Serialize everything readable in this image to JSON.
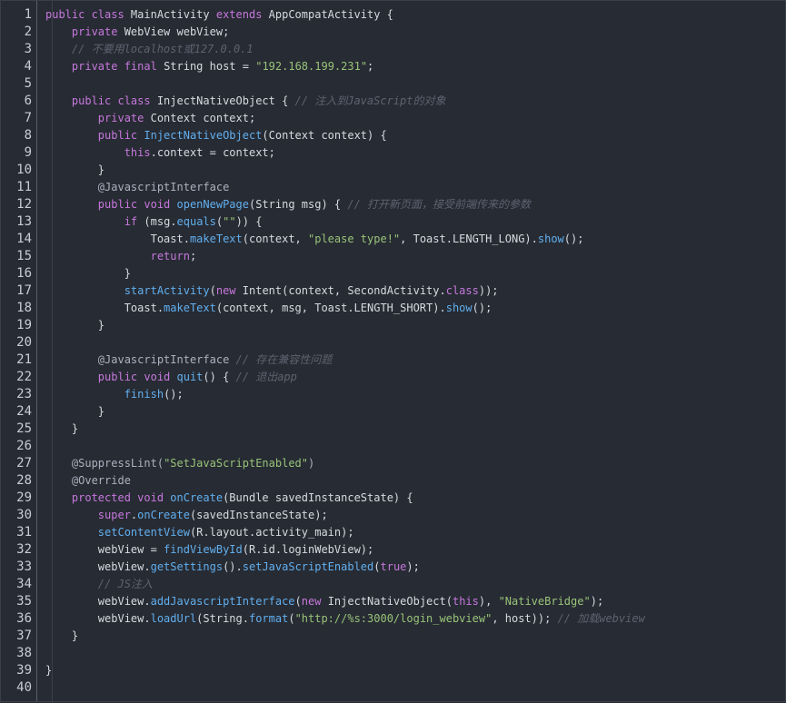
{
  "colors": {
    "background": "#272b33",
    "keyword": "#c678dd",
    "type": "#e5c07b",
    "function": "#61afef",
    "string": "#98c379",
    "comment": "#5c6370",
    "plain": "#d7dae0",
    "line_number": "#c8ccd4"
  },
  "lines": [
    {
      "n": "1",
      "t": [
        [
          "k",
          "public class "
        ],
        [
          "p",
          "MainActivity "
        ],
        [
          "k",
          "extends "
        ],
        [
          "p",
          "AppCompatActivity {"
        ]
      ]
    },
    {
      "n": "2",
      "t": [
        [
          "p",
          "    "
        ],
        [
          "k",
          "private "
        ],
        [
          "p",
          "WebView webView;"
        ]
      ]
    },
    {
      "n": "3",
      "t": [
        [
          "p",
          "    "
        ],
        [
          "c",
          "// 不要用localhost或127.0.0.1"
        ]
      ]
    },
    {
      "n": "4",
      "t": [
        [
          "p",
          "    "
        ],
        [
          "k",
          "private final "
        ],
        [
          "p",
          "String host = "
        ],
        [
          "s",
          "\"192.168.199.231\""
        ],
        [
          "p",
          ";"
        ]
      ]
    },
    {
      "n": "5",
      "t": []
    },
    {
      "n": "6",
      "t": [
        [
          "p",
          "    "
        ],
        [
          "k",
          "public class "
        ],
        [
          "p",
          "InjectNativeObject { "
        ],
        [
          "c",
          "// 注入到JavaScript的对象"
        ]
      ]
    },
    {
      "n": "7",
      "t": [
        [
          "p",
          "        "
        ],
        [
          "k",
          "private "
        ],
        [
          "p",
          "Context context;"
        ]
      ]
    },
    {
      "n": "8",
      "t": [
        [
          "p",
          "        "
        ],
        [
          "k",
          "public "
        ],
        [
          "f",
          "InjectNativeObject"
        ],
        [
          "p",
          "(Context context) {"
        ]
      ]
    },
    {
      "n": "9",
      "t": [
        [
          "p",
          "            "
        ],
        [
          "k",
          "this"
        ],
        [
          "p",
          ".context = context;"
        ]
      ]
    },
    {
      "n": "10",
      "t": [
        [
          "p",
          "        }"
        ]
      ]
    },
    {
      "n": "11",
      "t": [
        [
          "p",
          "        "
        ],
        [
          "a",
          "@JavascriptInterface"
        ]
      ]
    },
    {
      "n": "12",
      "t": [
        [
          "p",
          "        "
        ],
        [
          "k",
          "public void "
        ],
        [
          "f",
          "openNewPage"
        ],
        [
          "p",
          "(String msg) { "
        ],
        [
          "c",
          "// 打开新页面，接受前端传来的参数"
        ]
      ]
    },
    {
      "n": "13",
      "t": [
        [
          "p",
          "            "
        ],
        [
          "k",
          "if "
        ],
        [
          "p",
          "(msg."
        ],
        [
          "f",
          "equals"
        ],
        [
          "p",
          "("
        ],
        [
          "s",
          "\"\""
        ],
        [
          "p",
          ")) {"
        ]
      ]
    },
    {
      "n": "14",
      "t": [
        [
          "p",
          "                Toast."
        ],
        [
          "f",
          "makeText"
        ],
        [
          "p",
          "(context, "
        ],
        [
          "s",
          "\"please type!\""
        ],
        [
          "p",
          ", Toast.LENGTH_LONG)."
        ],
        [
          "f",
          "show"
        ],
        [
          "p",
          "();"
        ]
      ]
    },
    {
      "n": "15",
      "t": [
        [
          "p",
          "                "
        ],
        [
          "k",
          "return"
        ],
        [
          "p",
          ";"
        ]
      ]
    },
    {
      "n": "16",
      "t": [
        [
          "p",
          "            }"
        ]
      ]
    },
    {
      "n": "17",
      "t": [
        [
          "p",
          "            "
        ],
        [
          "f",
          "startActivity"
        ],
        [
          "p",
          "("
        ],
        [
          "k",
          "new "
        ],
        [
          "p",
          "Intent(context, SecondActivity."
        ],
        [
          "k",
          "class"
        ],
        [
          "p",
          "));"
        ]
      ]
    },
    {
      "n": "18",
      "t": [
        [
          "p",
          "            Toast."
        ],
        [
          "f",
          "makeText"
        ],
        [
          "p",
          "(context, msg, Toast.LENGTH_SHORT)."
        ],
        [
          "f",
          "show"
        ],
        [
          "p",
          "();"
        ]
      ]
    },
    {
      "n": "19",
      "t": [
        [
          "p",
          "        }"
        ]
      ]
    },
    {
      "n": "20",
      "t": []
    },
    {
      "n": "21",
      "t": [
        [
          "p",
          "        "
        ],
        [
          "a",
          "@JavascriptInterface "
        ],
        [
          "c",
          "// 存在兼容性问题"
        ]
      ]
    },
    {
      "n": "22",
      "t": [
        [
          "p",
          "        "
        ],
        [
          "k",
          "public void "
        ],
        [
          "f",
          "quit"
        ],
        [
          "p",
          "() { "
        ],
        [
          "c",
          "// 退出app"
        ]
      ]
    },
    {
      "n": "23",
      "t": [
        [
          "p",
          "            "
        ],
        [
          "f",
          "finish"
        ],
        [
          "p",
          "();"
        ]
      ]
    },
    {
      "n": "24",
      "t": [
        [
          "p",
          "        }"
        ]
      ]
    },
    {
      "n": "25",
      "t": [
        [
          "p",
          "    }"
        ]
      ]
    },
    {
      "n": "26",
      "t": []
    },
    {
      "n": "27",
      "t": [
        [
          "p",
          "    "
        ],
        [
          "a",
          "@SuppressLint("
        ],
        [
          "s",
          "\"SetJavaScriptEnabled\""
        ],
        [
          "a",
          ")"
        ]
      ]
    },
    {
      "n": "28",
      "t": [
        [
          "p",
          "    "
        ],
        [
          "a",
          "@Override"
        ]
      ]
    },
    {
      "n": "29",
      "t": [
        [
          "p",
          "    "
        ],
        [
          "k",
          "protected void "
        ],
        [
          "f",
          "onCreate"
        ],
        [
          "p",
          "(Bundle savedInstanceState) {"
        ]
      ]
    },
    {
      "n": "30",
      "t": [
        [
          "p",
          "        "
        ],
        [
          "k",
          "super"
        ],
        [
          "p",
          "."
        ],
        [
          "f",
          "onCreate"
        ],
        [
          "p",
          "(savedInstanceState);"
        ]
      ]
    },
    {
      "n": "31",
      "t": [
        [
          "p",
          "        "
        ],
        [
          "f",
          "setContentView"
        ],
        [
          "p",
          "(R.layout.activity_main);"
        ]
      ]
    },
    {
      "n": "32",
      "t": [
        [
          "p",
          "        webView = "
        ],
        [
          "f",
          "findViewById"
        ],
        [
          "p",
          "(R.id.loginWebView);"
        ]
      ]
    },
    {
      "n": "33",
      "t": [
        [
          "p",
          "        webView."
        ],
        [
          "f",
          "getSettings"
        ],
        [
          "p",
          "()."
        ],
        [
          "f",
          "setJavaScriptEnabled"
        ],
        [
          "p",
          "("
        ],
        [
          "k",
          "true"
        ],
        [
          "p",
          ");"
        ]
      ]
    },
    {
      "n": "34",
      "t": [
        [
          "p",
          "        "
        ],
        [
          "c",
          "// JS注入"
        ]
      ]
    },
    {
      "n": "35",
      "t": [
        [
          "p",
          "        webView."
        ],
        [
          "f",
          "addJavascriptInterface"
        ],
        [
          "p",
          "("
        ],
        [
          "k",
          "new "
        ],
        [
          "p",
          "InjectNativeObject("
        ],
        [
          "k",
          "this"
        ],
        [
          "p",
          "), "
        ],
        [
          "s",
          "\"NativeBridge\""
        ],
        [
          "p",
          ");"
        ]
      ]
    },
    {
      "n": "36",
      "t": [
        [
          "p",
          "        webView."
        ],
        [
          "f",
          "loadUrl"
        ],
        [
          "p",
          "(String."
        ],
        [
          "f",
          "format"
        ],
        [
          "p",
          "("
        ],
        [
          "s",
          "\"http://%s:3000/login_webview\""
        ],
        [
          "p",
          ", host)); "
        ],
        [
          "c",
          "// 加载webview"
        ]
      ]
    },
    {
      "n": "37",
      "t": [
        [
          "p",
          "    }"
        ]
      ]
    },
    {
      "n": "38",
      "t": []
    },
    {
      "n": "39",
      "t": [
        [
          "p",
          "}"
        ]
      ]
    },
    {
      "n": "40",
      "t": []
    }
  ]
}
